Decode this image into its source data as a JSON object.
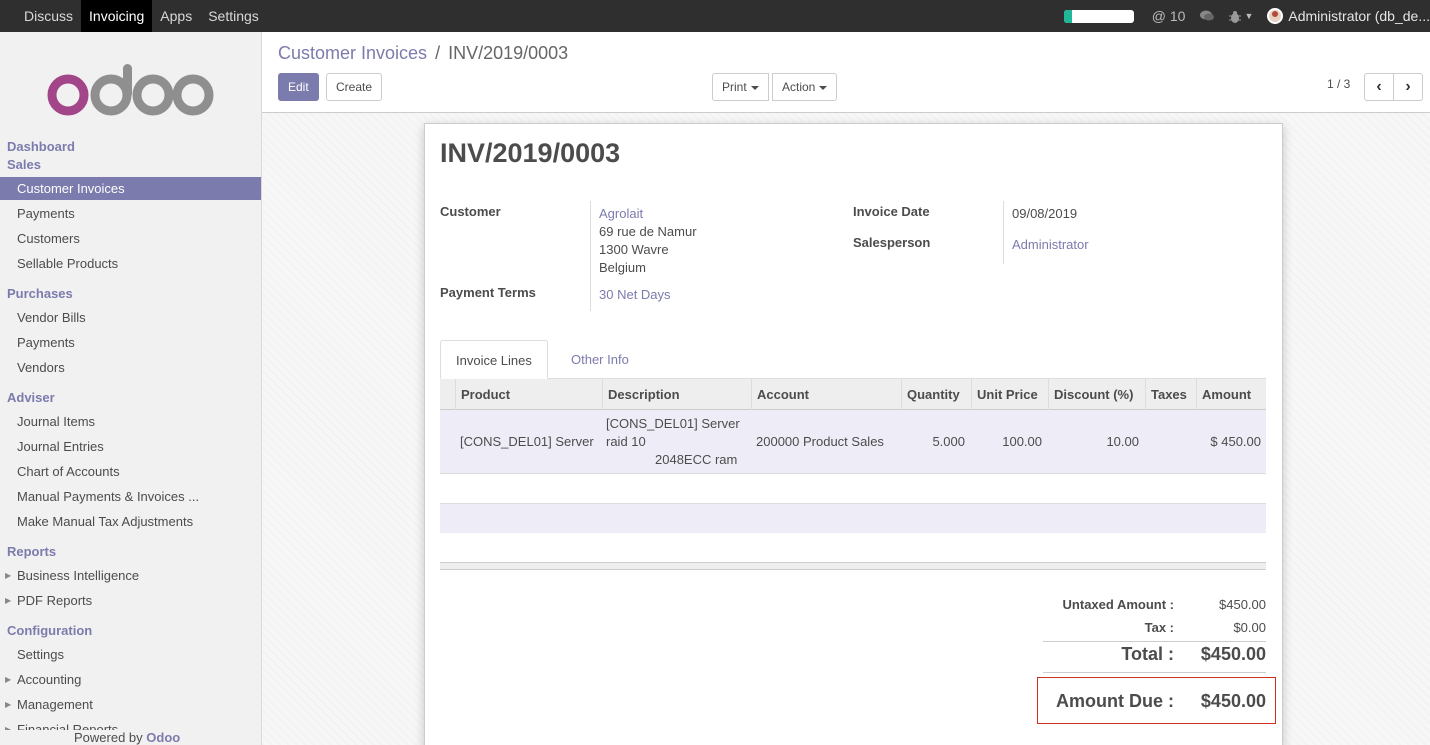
{
  "topbar": {
    "menu": [
      "Discuss",
      "Invoicing",
      "Apps",
      "Settings"
    ],
    "active_menu": "Invoicing",
    "progress": 0.12,
    "mentions_count": "@ 10",
    "user": "Administrator (db_de..."
  },
  "sidebar": {
    "sections": [
      {
        "title": "Dashboard"
      },
      {
        "title": "Sales",
        "items": [
          "Customer Invoices",
          "Payments",
          "Customers",
          "Sellable Products"
        ]
      },
      {
        "title": "Purchases",
        "items": [
          "Vendor Bills",
          "Payments",
          "Vendors"
        ]
      },
      {
        "title": "Adviser",
        "items": [
          "Journal Items",
          "Journal Entries",
          "Chart of Accounts",
          "Manual Payments & Invoices ...",
          "Make Manual Tax Adjustments"
        ]
      },
      {
        "title": "Reports",
        "items": [
          "Business Intelligence",
          "PDF Reports"
        ]
      },
      {
        "title": "Configuration",
        "items": [
          "Settings",
          "Accounting",
          "Management",
          "Financial Reports"
        ]
      }
    ],
    "active_item": "Customer Invoices",
    "powered_by": "Powered by",
    "powered_brand": "Odoo"
  },
  "control": {
    "breadcrumb_parent": "Customer Invoices",
    "breadcrumb_sep": "/",
    "breadcrumb_current": "INV/2019/0003",
    "edit_label": "Edit",
    "create_label": "Create",
    "print_label": "Print",
    "action_label": "Action",
    "pager": "1 / 3"
  },
  "invoice": {
    "number": "INV/2019/0003",
    "customer_label": "Customer",
    "customer_name": "Agrolait",
    "customer_addr1": "69 rue de Namur",
    "customer_addr2": "1300 Wavre",
    "customer_addr3": "Belgium",
    "payment_terms_label": "Payment Terms",
    "payment_terms": "30 Net Days",
    "invoice_date_label": "Invoice Date",
    "invoice_date": "09/08/2019",
    "salesperson_label": "Salesperson",
    "salesperson": "Administrator"
  },
  "tabs": [
    "Invoice Lines",
    "Other Info"
  ],
  "lines": {
    "headers": [
      "Product",
      "Description",
      "Account",
      "Quantity",
      "Unit Price",
      "Discount (%)",
      "Taxes",
      "Amount"
    ],
    "rows": [
      {
        "product": "[CONS_DEL01] Server",
        "desc1": "[CONS_DEL01] Server",
        "desc2": "raid 10",
        "desc3": "2048ECC ram",
        "account": "200000 Product Sales",
        "quantity": "5.000",
        "unit_price": "100.00",
        "discount": "10.00",
        "taxes": "",
        "amount": "$ 450.00"
      }
    ]
  },
  "totals": {
    "untaxed_label": "Untaxed Amount :",
    "untaxed": "$450.00",
    "tax_label": "Tax :",
    "tax": "$0.00",
    "total_label": "Total :",
    "total": "$450.00",
    "due_label": "Amount Due :",
    "due": "$450.00"
  },
  "colors": {
    "accent": "#7c7bad",
    "topbar": "#2f2f2f",
    "highlight": "#d0301e",
    "progress": "#21b799"
  }
}
